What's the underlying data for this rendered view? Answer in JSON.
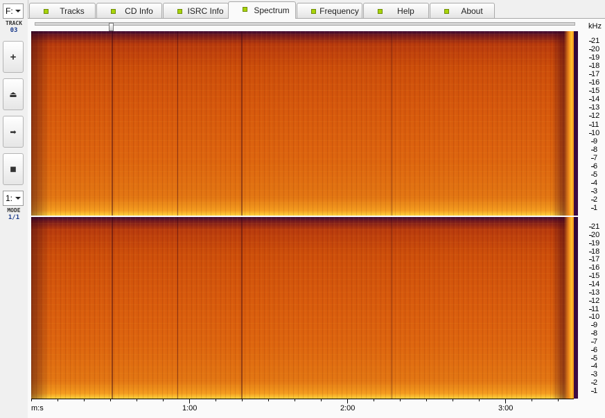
{
  "sidebar": {
    "drive": "F:",
    "track_label": "TRACK",
    "track_value": "03",
    "buttons": [
      {
        "name": "add-button",
        "icon": "plus-icon",
        "glyph": "+"
      },
      {
        "name": "eject-button",
        "icon": "eject-icon",
        "glyph": "⏏"
      },
      {
        "name": "play-button",
        "icon": "arrow-right-icon",
        "glyph": "➡"
      },
      {
        "name": "stop-button",
        "icon": "stop-icon",
        "glyph": "■"
      }
    ],
    "mode_select": "1:",
    "mode_label": "MODE",
    "mode_value": "1/1"
  },
  "tabs": [
    {
      "label": "Tracks",
      "active": false
    },
    {
      "label": "CD Info",
      "active": false
    },
    {
      "label": "ISRC Info",
      "active": false
    },
    {
      "label": "Spectrum",
      "active": true
    },
    {
      "label": "Frequency",
      "active": false
    },
    {
      "label": "Help",
      "active": false
    },
    {
      "label": "About",
      "active": false
    }
  ],
  "spectrum": {
    "frequency_unit": "kHz",
    "channels": 2,
    "frequency_ticks": [
      21,
      20,
      19,
      18,
      17,
      16,
      15,
      14,
      13,
      12,
      11,
      10,
      9,
      8,
      7,
      6,
      5,
      4,
      3,
      2,
      1
    ],
    "time_unit": "m:s",
    "time_labels": [
      "1:00",
      "2:00",
      "3:00"
    ],
    "colors": {
      "low_energy": "#3c0b35",
      "mid_energy": "#d7590c",
      "high_energy": "#ffd23c"
    }
  }
}
